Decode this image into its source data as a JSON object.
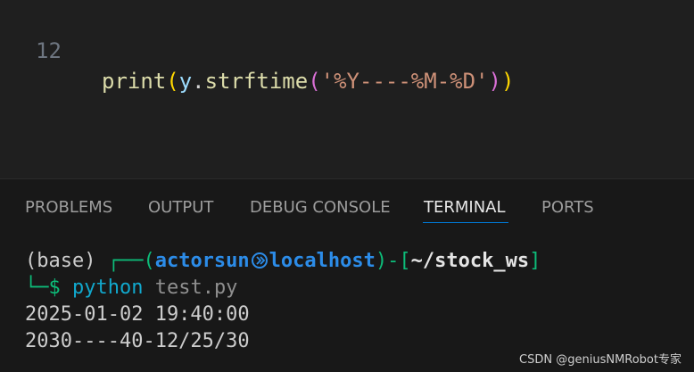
{
  "editor": {
    "line": {
      "number": "12",
      "fn": "print",
      "open_paren": "(",
      "var": "y",
      "dot": ".",
      "method": "strftime",
      "open_paren2": "(",
      "string": "'%Y----%M-%D'",
      "close_paren2": ")",
      "close_paren": ")"
    }
  },
  "panel": {
    "tabs": [
      {
        "label": "PROBLEMS"
      },
      {
        "label": "OUTPUT"
      },
      {
        "label": "DEBUG CONSOLE"
      },
      {
        "label": "TERMINAL"
      },
      {
        "label": "PORTS"
      }
    ],
    "active_tab": "TERMINAL"
  },
  "terminal": {
    "prompt": {
      "env": "(base) ",
      "box_top": "┌──(",
      "user": "actorsun",
      "host": "localhost",
      "sep": ")-[",
      "path": "~/stock_ws",
      "close": "]",
      "box_bottom": "└─$ ",
      "command": "python",
      "arg": " test.py"
    },
    "output": [
      "2025-01-02 19:40:00",
      "2030----40-12/25/30"
    ]
  },
  "watermark": "CSDN @geniusNMRobot专家",
  "colors": {
    "editor_bg": "#1f1f1f",
    "panel_bg": "#181818",
    "accent": "#0078d4",
    "prompt_green": "#0dbc79",
    "prompt_blue": "#2c8ce8"
  }
}
